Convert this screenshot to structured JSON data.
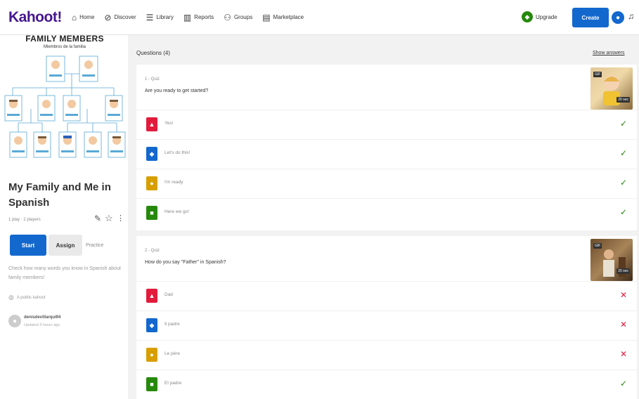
{
  "header": {
    "logo": "Kahoot!",
    "nav": [
      {
        "label": "Home",
        "icon": "⌂"
      },
      {
        "label": "Discover",
        "icon": "⊘"
      },
      {
        "label": "Library",
        "icon": "☰"
      },
      {
        "label": "Reports",
        "icon": "▥"
      },
      {
        "label": "Groups",
        "icon": "⚇"
      },
      {
        "label": "Marketplace",
        "icon": "▤"
      }
    ],
    "upgrade_label": "Upgrade",
    "create_label": "Create"
  },
  "kahoot": {
    "image_title": "FAMILY MEMBERS",
    "image_subtitle": "Miembros de la familia",
    "title": "My Family and Me in Spanish",
    "meta": "1 play · 2 players",
    "start_label": "Start",
    "assign_label": "Assign",
    "practice_label": "Practice",
    "description": "Check how many words you know in Spanish about family members!",
    "visibility": "A public kahoot",
    "creator": "denisdevillarqui94",
    "updated": "Updated 3 hours ago"
  },
  "questions_header": "Questions (4)",
  "show_answers": "Show answers",
  "colors": {
    "red": "#e21b3c",
    "blue": "#1368ce",
    "yellow": "#d89e00",
    "green": "#26890c"
  },
  "questions": [
    {
      "number": "1 - Quiz",
      "text": "Are you ready to get started?",
      "gif": "GIF",
      "time": "20 sec",
      "answers": [
        {
          "text": "Yes!",
          "correct": true
        },
        {
          "text": "Let's do this!",
          "correct": true
        },
        {
          "text": "I'm ready",
          "correct": true
        },
        {
          "text": "Here we go!",
          "correct": true
        }
      ]
    },
    {
      "number": "2 - Quiz",
      "text": "How do you say \"Father\" in Spanish?",
      "gif": "GIF",
      "time": "20 sec",
      "answers": [
        {
          "text": "Dad",
          "correct": false
        },
        {
          "text": "Il padre",
          "correct": false
        },
        {
          "text": "Le père",
          "correct": false
        },
        {
          "text": "El padre",
          "correct": true
        }
      ]
    }
  ]
}
